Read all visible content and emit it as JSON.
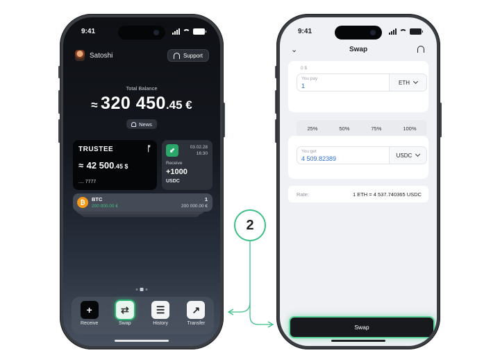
{
  "step_number": "2",
  "colors": {
    "accent_green": "#3fc08a",
    "btc_orange": "#f39a1a",
    "link_blue": "#2e6fd0"
  },
  "left_screen": {
    "status_time": "9:41",
    "user_name": "Satoshi",
    "support_label": "Support",
    "total_balance_label": "Total Balance",
    "total_balance": {
      "approx": "≈",
      "integer": "320 450",
      "decimal": ".45 €"
    },
    "news_label": "News",
    "trustee_card": {
      "brand": "TRUSTEE",
      "approx": "≈",
      "amount_int": "42 500",
      "amount_dec": ".45 $",
      "masked_number": ".... 7777"
    },
    "receive_card": {
      "date": "03.02.28",
      "time": "16:30",
      "label": "Receive",
      "value": "+1000",
      "currency": "USDC"
    },
    "asset": {
      "symbol": "BTC",
      "fiat_left": "200 000.00 €",
      "quantity": "1",
      "fiat_right": "200 000.00 €"
    },
    "actions": [
      {
        "label": "Receive",
        "icon": "plus-icon"
      },
      {
        "label": "Swap",
        "icon": "swap-icon"
      },
      {
        "label": "History",
        "icon": "history-icon"
      },
      {
        "label": "Transfer",
        "icon": "transfer-icon"
      }
    ]
  },
  "right_screen": {
    "status_time": "9:41",
    "title": "Swap",
    "balance_hint": "0 $",
    "pay": {
      "label": "You pay",
      "value": "1",
      "currency": "ETH"
    },
    "percent_options": [
      "25%",
      "50%",
      "75%",
      "100%"
    ],
    "get": {
      "label": "You get",
      "value": "4 509.82389",
      "currency": "USDC"
    },
    "rate": {
      "label": "Rate:",
      "value": "1 ETH = 4 537.740365 USDC"
    },
    "swap_button_label": "Swap"
  }
}
